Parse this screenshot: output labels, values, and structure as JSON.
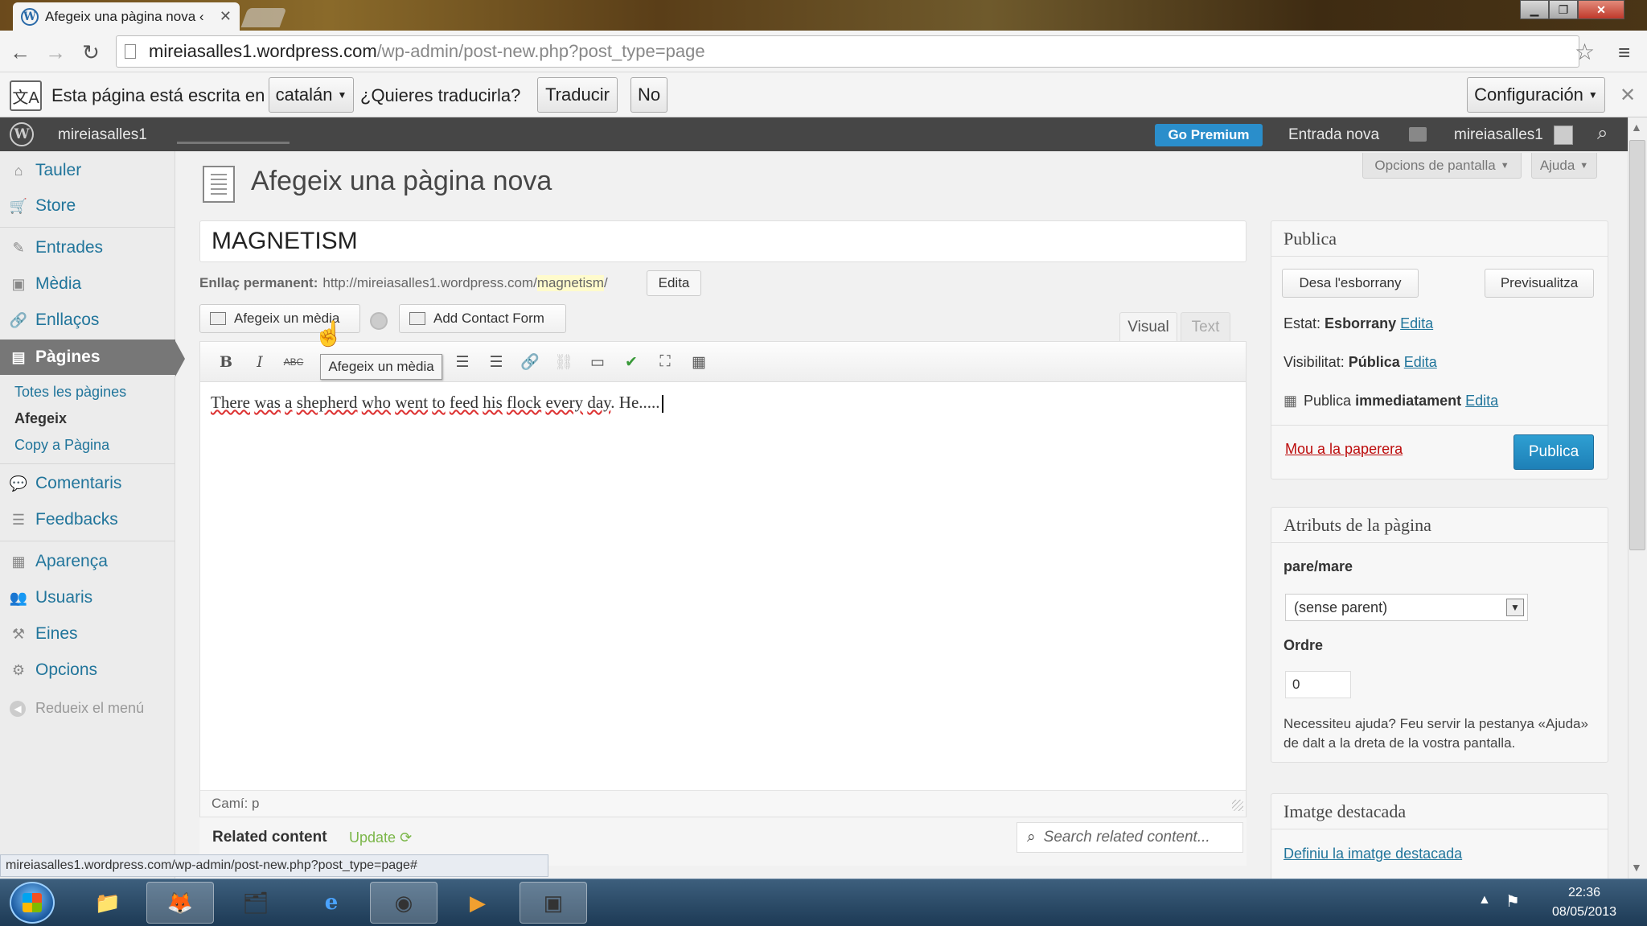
{
  "browser": {
    "tab_title": "Afegeix una pàgina nova ‹",
    "url_host": "mireiasalles1.wordpress.com",
    "url_path": "/wp-admin/post-new.php?post_type=page",
    "status_url": "mireiasalles1.wordpress.com/wp-admin/post-new.php?post_type=page#"
  },
  "translate_bar": {
    "prefix": "Esta página está escrita en",
    "language": "catalán",
    "question": "¿Quieres traducirla?",
    "translate_label": "Traducir",
    "no_label": "No",
    "config_label": "Configuración"
  },
  "admin_bar": {
    "site_name": "mireiasalles1",
    "go_premium": "Go Premium",
    "new_post": "Entrada nova",
    "user": "mireiasalles1"
  },
  "sidebar": {
    "items": [
      {
        "label": "Tauler",
        "icon": "dashboard-icon"
      },
      {
        "label": "Store",
        "icon": "cart-icon"
      },
      {
        "label": "Entrades",
        "icon": "pin-icon"
      },
      {
        "label": "Mèdia",
        "icon": "media-icon"
      },
      {
        "label": "Enllaços",
        "icon": "link-icon"
      },
      {
        "label": "Pàgines",
        "icon": "pages-icon"
      },
      {
        "label": "Comentaris",
        "icon": "comment-icon"
      },
      {
        "label": "Feedbacks",
        "icon": "feedback-icon"
      },
      {
        "label": "Aparença",
        "icon": "appearance-icon"
      },
      {
        "label": "Usuaris",
        "icon": "users-icon"
      },
      {
        "label": "Eines",
        "icon": "tools-icon"
      },
      {
        "label": "Opcions",
        "icon": "settings-icon"
      }
    ],
    "sub_items": [
      "Totes les pàgines",
      "Afegeix",
      "Copy a Pàgina"
    ],
    "collapse_label": "Redueix el menú"
  },
  "main": {
    "heading": "Afegeix una pàgina nova",
    "screen_options": "Opcions de pantalla",
    "help": "Ajuda",
    "title_value": "MAGNETISM",
    "permalink_label": "Enllaç permanent:",
    "permalink_base": "http://mireiasalles1.wordpress.com/",
    "permalink_slug": "magnetism",
    "permalink_suffix": "/",
    "permalink_edit": "Edita",
    "add_media": "Afegeix un mèdia",
    "add_contact_form": "Add Contact Form",
    "tab_visual": "Visual",
    "tab_text": "Text",
    "tooltip": "Afegeix un mèdia",
    "body_words": [
      "There",
      "was",
      "a",
      "shepherd",
      "who",
      "went",
      "to",
      "feed",
      "his",
      "flock",
      "every",
      "day",
      ". He....."
    ],
    "path": "Camí: p",
    "related_title": "Related content",
    "related_update": "Update",
    "related_search_placeholder": "Search related content..."
  },
  "publish_box": {
    "title": "Publica",
    "save_draft": "Desa l'esborrany",
    "preview": "Previsualitza",
    "status_label": "Estat:",
    "status_value": "Esborrany",
    "visibility_label": "Visibilitat:",
    "visibility_value": "Pública",
    "publish_label": "Publica",
    "publish_value": "immediatament",
    "edit": "Edita",
    "trash": "Mou a la paperera",
    "publish_button": "Publica"
  },
  "attributes_box": {
    "title": "Atributs de la pàgina",
    "parent_label": "pare/mare",
    "parent_value": "(sense parent)",
    "order_label": "Ordre",
    "order_value": "0",
    "help_text": "Necessiteu ajuda? Feu servir la pestanya «Ajuda» de dalt a la dreta de la vostra pantalla."
  },
  "featured_box": {
    "title": "Imatge destacada",
    "link": "Definiu la imatge destacada"
  },
  "taskbar": {
    "time": "22:36",
    "date": "08/05/2013"
  }
}
